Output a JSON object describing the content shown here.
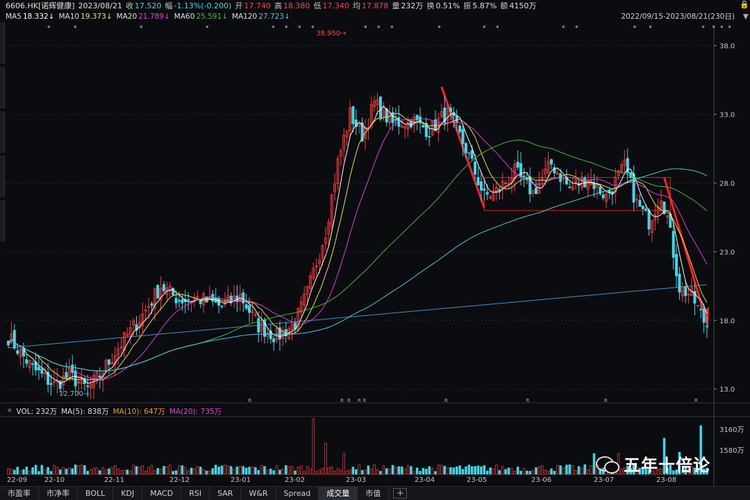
{
  "header": {
    "code": "6606.HK[诺辉健康]",
    "date": "2023/08/21",
    "close_label": "收",
    "close": "17.520",
    "change_label": "幅",
    "change": "-1.13%(-0.200)",
    "open_label": "开",
    "open": "17.740",
    "high_label": "高",
    "high": "18.380",
    "low_label": "低",
    "low": "17.340",
    "avg_label": "均",
    "avg": "17.878",
    "vol_label": "量",
    "vol": "232万",
    "turnover_label": "换",
    "turnover": "0.51%",
    "amp_label": "振",
    "amp": "5.87%",
    "amount_label": "额",
    "amount": "4150万",
    "range": "2022/09/15-2023/08/21(230日)"
  },
  "ma_legend": {
    "ma5": "MA5",
    "ma5_val": "18.332↓",
    "ma10": "MA10",
    "ma10_val": "19.373↓",
    "ma20": "MA20",
    "ma20_val": "21.789↓",
    "ma60": "MA60",
    "ma60_val": "25.591↓",
    "ma120": "MA120",
    "ma120_val": "27.723↓"
  },
  "vol_legend": {
    "vol": "VOL: 232万",
    "ma5": "MA(5): 838万",
    "ma10": "MA(10): 647万",
    "ma20": "MA(20): 735万"
  },
  "annotations": {
    "high": "38.950",
    "low": "12.700"
  },
  "chart_data": {
    "type": "candlestick",
    "title": "6606.HK[诺辉健康]",
    "price_axis_ticks": [
      38.0,
      33.0,
      28.0,
      23.0,
      18.0,
      13.0
    ],
    "price_axis_labels": [
      "38.0",
      "33.0",
      "28.0",
      "23.0",
      "18.0",
      "13.0"
    ],
    "ylim": [
      12.0,
      39.5
    ],
    "volume_axis_labels": [
      "3160万",
      "1580万"
    ],
    "x_tick_labels": [
      "22-09",
      "22-10",
      "22-11",
      "22-12",
      "23-01",
      "23-02",
      "23-03",
      "23-04",
      "23-05",
      "23-06",
      "23-07",
      "23-08"
    ],
    "key_points": [
      {
        "date": "2022-10",
        "price": 12.7,
        "label": "low"
      },
      {
        "date": "2023-02",
        "price": 38.95,
        "label": "high"
      },
      {
        "date": "2023-08-21",
        "open": 17.74,
        "high": 18.38,
        "low": 17.34,
        "close": 17.52
      }
    ],
    "moving_averages": [
      {
        "name": "MA5",
        "value": 18.332,
        "color": "#ffffff"
      },
      {
        "name": "MA10",
        "value": 19.373,
        "color": "#e8e84a"
      },
      {
        "name": "MA20",
        "value": 21.789,
        "color": "#e040e0"
      },
      {
        "name": "MA60",
        "value": 25.591,
        "color": "#3fbf3f"
      },
      {
        "name": "MA120",
        "value": 27.723,
        "color": "#58c8e0"
      }
    ],
    "colors": {
      "up": "#ff3b3b",
      "down": "#3fd8e8",
      "box": "#e02020",
      "trend": "#ff2020"
    }
  },
  "tabs": [
    "市盈率",
    "市净率",
    "BOLL",
    "KDJ",
    "MACD",
    "RSI",
    "SAR",
    "W&R",
    "Spread",
    "成交量",
    "市值"
  ],
  "active_tab": "成交量",
  "watermark": {
    "text": "五年十倍论"
  }
}
